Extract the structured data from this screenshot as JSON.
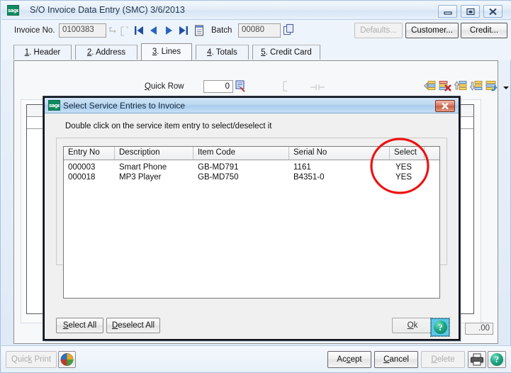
{
  "window": {
    "title": "S/O Invoice Data Entry (SMC) 3/6/2013",
    "logo_text": "sage",
    "buttons": {
      "minimize": "minimize-button",
      "maximize": "maximize-button",
      "close": "close-button"
    }
  },
  "header": {
    "invoice_label": "Invoice No.",
    "invoice_value": "0100383",
    "batch_label": "Batch",
    "batch_value": "00080",
    "nav": {
      "first": "|◀",
      "prev": "◀",
      "next": "▶",
      "last": "▶|",
      "list": "list-icon"
    },
    "defaults_button": "Defaults...",
    "customer_button": "Customer...",
    "credit_button": "Credit..."
  },
  "tabs": [
    {
      "key": "header",
      "accel": "1",
      "label": ". Header",
      "active": false
    },
    {
      "key": "address",
      "accel": "2",
      "label": ". Address",
      "active": false
    },
    {
      "key": "lines",
      "accel": "3",
      "label": ". Lines",
      "active": true
    },
    {
      "key": "totals",
      "accel": "4",
      "label": ". Totals",
      "active": false
    },
    {
      "key": "creditcard",
      "accel": "5",
      "label": ". Credit Card",
      "active": false
    }
  ],
  "lines_toolbar": {
    "quick_row_label": "Quick Row",
    "quick_row_accel": "Q",
    "quick_row_value": "0",
    "lookup_icon": "row-lookup-icon",
    "grid_icons": [
      "insert-row-icon",
      "delete-row-icon",
      "move-row-up-icon",
      "move-row-down-icon",
      "row-options-icon"
    ],
    "dropdown_arrow": "chevron-down-icon"
  },
  "lines_panel": {
    "total_field_value": ".00"
  },
  "dialog": {
    "title": "Select Service Entries to Invoice",
    "logo_text": "sage",
    "close_label": "✕",
    "hint": "Double click on the service item entry to select/deselect it",
    "columns": [
      "Entry No",
      "Description",
      "Item Code",
      "Serial No",
      "Select"
    ],
    "rows": [
      {
        "entry_no": "000003",
        "description": "Smart Phone",
        "item_code": "GB-MD791",
        "serial_no": "1161",
        "select": "YES"
      },
      {
        "entry_no": "000018",
        "description": "MP3 Player",
        "item_code": "GB-MD750",
        "serial_no": "B4351-0",
        "select": "YES"
      }
    ],
    "buttons": {
      "select_all": "Select All",
      "select_all_accel": "S",
      "deselect_all": "Deselect All",
      "deselect_all_accel": "D",
      "ok": "Ok",
      "ok_accel": "O",
      "help": "?"
    },
    "annotation": {
      "shape": "ellipse",
      "color": "#ee1111",
      "target_column": "Select"
    }
  },
  "footer": {
    "quick_print": "Quick Print",
    "quick_print_accel": "k",
    "quick_print_icon": "globe-icon",
    "accept": "Accept",
    "accept_accel": "c",
    "cancel": "Cancel",
    "cancel_accel": "C",
    "delete": "Delete",
    "delete_accel": "D",
    "print_icon": "printer-icon",
    "help_icon": "help-orb-icon"
  },
  "colors": {
    "titlebar_accent": "#d6e4f4",
    "dialog_titlebar": "#bcd8f0",
    "annotation_red": "#ee1111",
    "sage_green": "#0f8a5f",
    "help_orb_green": "#1fa683"
  }
}
